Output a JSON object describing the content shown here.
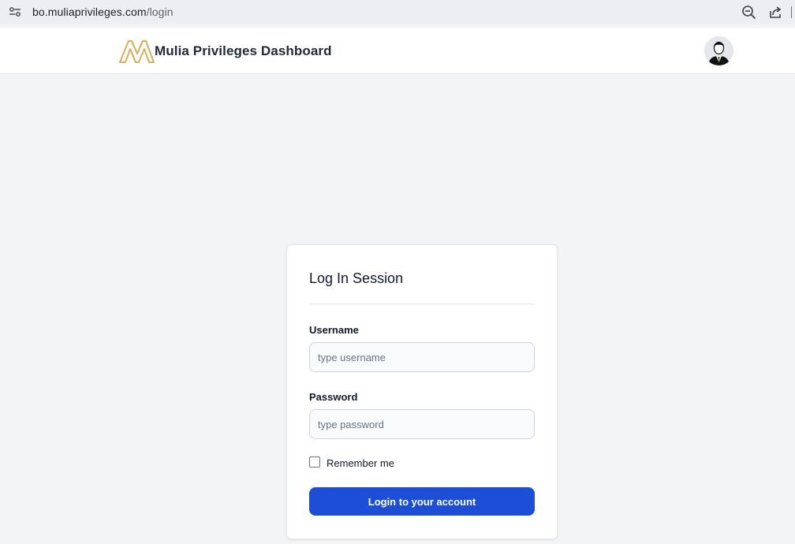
{
  "browser": {
    "url_host": "bo.muliaprivileges.com",
    "url_path": "/login",
    "icons": [
      "site-info-icon",
      "zoom-out-icon",
      "share-icon"
    ]
  },
  "header": {
    "title": "Mulia Privileges Dashboard",
    "logo_icon": "mulia-logo",
    "avatar_icon": "user-avatar",
    "logo_color": "#d4b56a"
  },
  "login": {
    "title": "Log In Session",
    "username_label": "Username",
    "username_placeholder": "type username",
    "username_value": "",
    "password_label": "Password",
    "password_placeholder": "type password",
    "password_value": "",
    "remember_label": "Remember me",
    "remember_checked": false,
    "submit_label": "Login to your account",
    "accent_color": "#1d4ed8"
  }
}
